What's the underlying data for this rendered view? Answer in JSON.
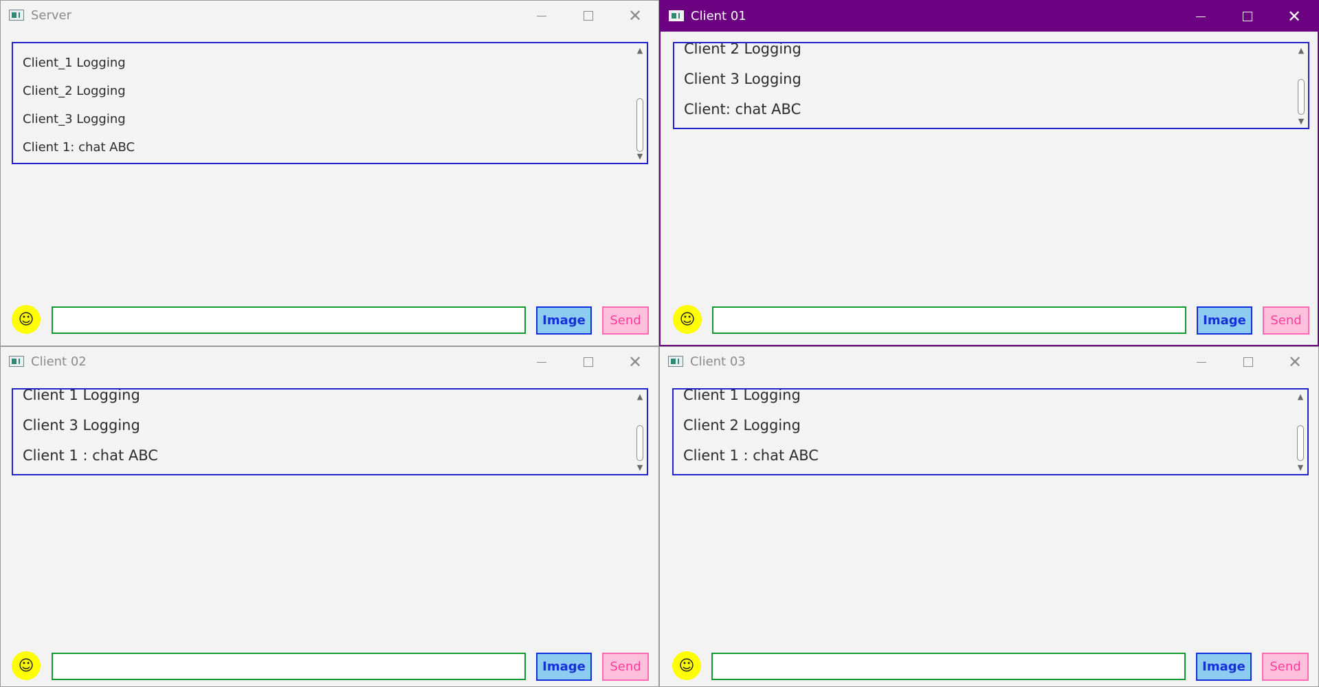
{
  "colors": {
    "active_title_bar": "#6b0080",
    "list_border": "#1e22c8",
    "input_border": "#119a2c",
    "image_button_bg": "#8ecbf1",
    "image_button_border": "#0f2fd9",
    "send_button_bg": "#ffc0dc",
    "send_button_border": "#ff69b4",
    "emoji_button_bg": "#ffff00"
  },
  "windows": [
    {
      "title": "Server",
      "active": false,
      "messages": [
        "Client_1 Logging",
        "Client_2 Logging",
        "Client_3 Logging",
        "Client 1: chat ABC"
      ],
      "input_value": "",
      "emoji_label": "☺",
      "image_label": "Image",
      "send_label": "Send"
    },
    {
      "title": "Client 01",
      "active": true,
      "messages": [
        "Client 2 Logging",
        "Client 3 Logging",
        "Client: chat ABC"
      ],
      "input_value": "",
      "emoji_label": "☺",
      "image_label": "Image",
      "send_label": "Send"
    },
    {
      "title": "Client 02",
      "active": false,
      "messages": [
        "Client 1 Logging",
        "Client 3 Logging",
        "Client 1 : chat ABC"
      ],
      "input_value": "",
      "emoji_label": "☺",
      "image_label": "Image",
      "send_label": "Send"
    },
    {
      "title": "Client 03",
      "active": false,
      "messages": [
        "Client 1 Logging",
        "Client 2 Logging",
        "Client 1 : chat ABC"
      ],
      "input_value": "",
      "emoji_label": "☺",
      "image_label": "Image",
      "send_label": "Send"
    }
  ],
  "icons": {
    "app": "app-window-icon",
    "minimize": "minimize-icon",
    "maximize": "maximize-icon",
    "close": "close-icon",
    "scroll_up": "scroll-up-arrow-icon",
    "scroll_down": "scroll-down-arrow-icon",
    "emoji": "smiley-icon"
  }
}
